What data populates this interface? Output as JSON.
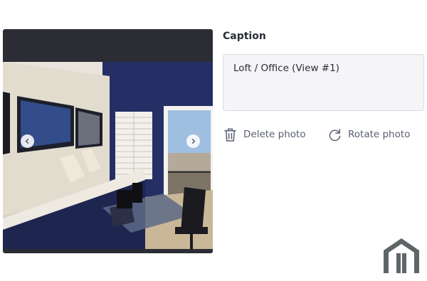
{
  "caption": {
    "label": "Caption",
    "value": "Loft / Office (View #1)"
  },
  "actions": {
    "delete_label": "Delete photo",
    "rotate_label": "Rotate photo"
  },
  "icons": {
    "prev": "chevron-left-icon",
    "next": "chevron-right-icon",
    "delete": "trash-icon",
    "rotate": "rotate-icon",
    "logo": "house-logo-icon"
  },
  "colors": {
    "viewer_bg": "#2c2c34",
    "action_text": "#5b6172",
    "logo": "#5f6668"
  }
}
